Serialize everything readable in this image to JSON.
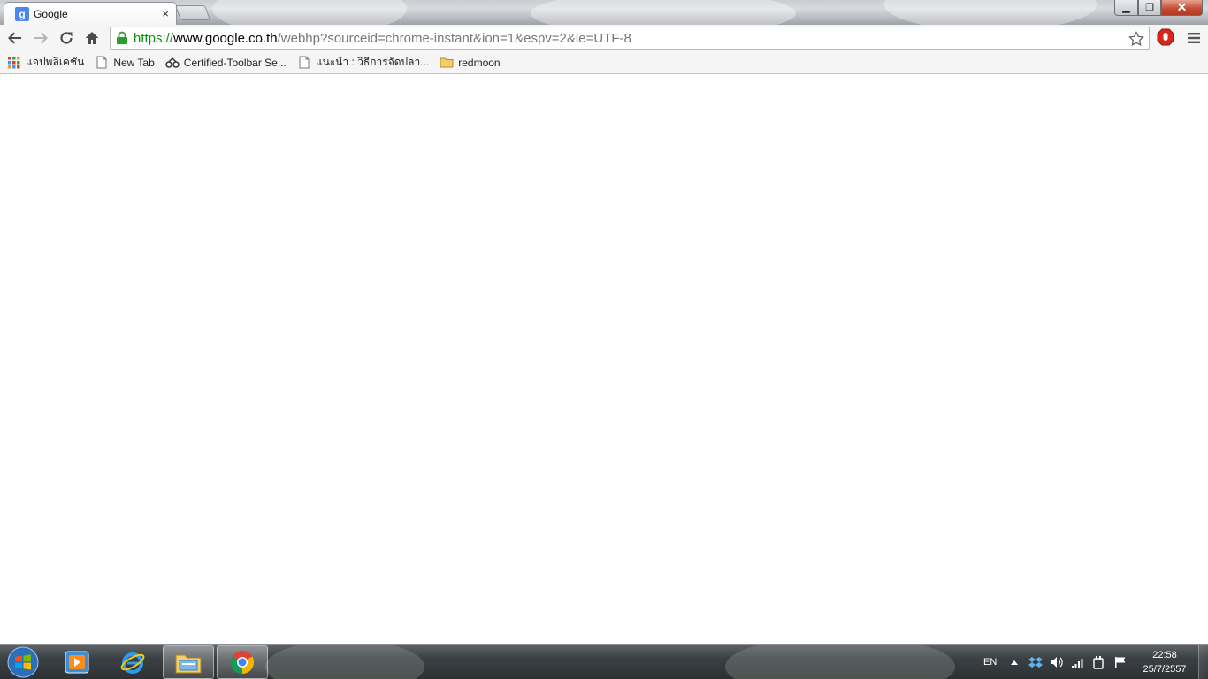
{
  "browser": {
    "tab": {
      "title": "Google",
      "favicon": "google-g-icon",
      "close_glyph": "×"
    },
    "window_controls": {
      "minimize": "▁",
      "maximize": "❐",
      "close": "✕"
    },
    "omnibox": {
      "scheme": "https://",
      "host": "www.google.co.th",
      "path": "/webhp?sourceid=chrome-instant&ion=1&espv=2&ie=UTF-8"
    },
    "accent_colors": {
      "secure_green": "#009900",
      "extension_red": "#d9261c",
      "close_red": "#c24a31"
    }
  },
  "bookmarks": {
    "items": [
      {
        "label": "แอปพลิเคชัน",
        "icon": "apps-grid-icon"
      },
      {
        "label": "New Tab",
        "icon": "page-icon"
      },
      {
        "label": "Certified-Toolbar Se...",
        "icon": "toolbar-icon"
      },
      {
        "label": "แนะนำ : วิธีการจัดปลา...",
        "icon": "page-icon"
      },
      {
        "label": "redmoon",
        "icon": "folder-icon"
      }
    ]
  },
  "taskbar": {
    "language": "EN",
    "clock": {
      "time": "22:58",
      "date": "25/7/2557"
    },
    "apps": [
      "media-player-icon",
      "internet-explorer-icon",
      "file-explorer-icon",
      "chrome-icon"
    ]
  }
}
